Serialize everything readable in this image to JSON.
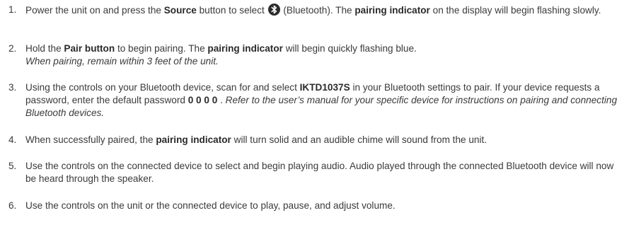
{
  "steps": [
    {
      "num": "1.",
      "t1": "Power the unit on and press the ",
      "b1": "Source",
      "t2": " button to select ",
      "icon": "bluetooth-icon",
      "t3": " (Bluetooth). The ",
      "b2": "pairing indicator",
      "t4": " on the display will begin flashing slowly."
    },
    {
      "num": "2.",
      "t1": "Hold the ",
      "b1": "Pair button",
      "t2": " to begin pairing. The ",
      "b2": "pairing indicator",
      "t3": " will begin quickly flashing blue.",
      "i1": "When pairing, remain within 3 feet of the unit."
    },
    {
      "num": "3.",
      "t1": "Using the controls on your Bluetooth device, scan for and select ",
      "b1": "IKTD1037S",
      "t2": " in your Bluetooth settings to pair. If your device requests a password, enter the default password ",
      "b2": "0 0 0 0",
      "t3": " . ",
      "i1": "Refer to the user’s manual for your specific device for instructions on pairing and connecting Bluetooth devices."
    },
    {
      "num": "4.",
      "t1": "When successfully paired, the ",
      "b1": "pairing indicator",
      "t2": " will turn solid and an audible chime will sound from the unit."
    },
    {
      "num": "5.",
      "t1": "Use the controls on the connected device to select and begin playing audio. Audio played through the connected Bluetooth device will now be heard through the speaker."
    },
    {
      "num": "6.",
      "t1": "Use the controls on the unit or the connected device to play, pause, and adjust volume."
    }
  ]
}
